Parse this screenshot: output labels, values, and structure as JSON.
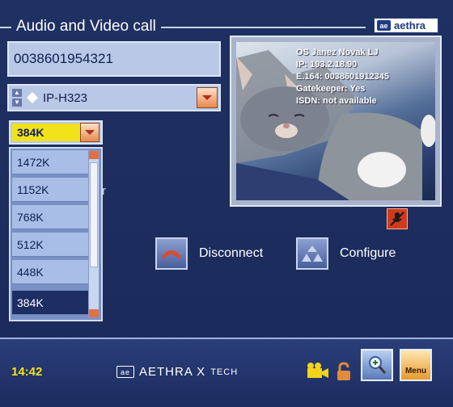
{
  "window": {
    "title": "Audio and Video call",
    "brand": "aethra",
    "brand_mark": "ae"
  },
  "call_form": {
    "number_value": "0038601954321",
    "protocol_value": "IP-H323",
    "bitrate_value": "384K",
    "bitrate_options": [
      "1472K",
      "1152K",
      "768K",
      "512K",
      "448K",
      "384K"
    ],
    "hidden_label_fragment": "r"
  },
  "video_preview": {
    "info_lines": [
      "OS Janez Novak LJ",
      "IP: 193.2.18.90",
      "E.164: 0038601912345",
      "Gatekeeper: Yes",
      "ISDN: not available"
    ]
  },
  "actions": {
    "disconnect_label": "Disconnect",
    "configure_label": "Configure"
  },
  "status_bar": {
    "time": "14:42",
    "footer_brand_main": "AETHRA X",
    "footer_brand_suffix": "TECH",
    "footer_brand_mark": "ae",
    "menu_label": "Menu"
  },
  "icons": {
    "mic": "mic-muted-icon",
    "camera": "camera-icon",
    "lock": "lock-icon",
    "zoom": "zoom-icon",
    "disconnect": "hangup-icon",
    "configure": "configure-icon"
  },
  "colors": {
    "background": "#1c2c5c",
    "highlight": "#f2e21a",
    "accent": "#e68a50"
  }
}
